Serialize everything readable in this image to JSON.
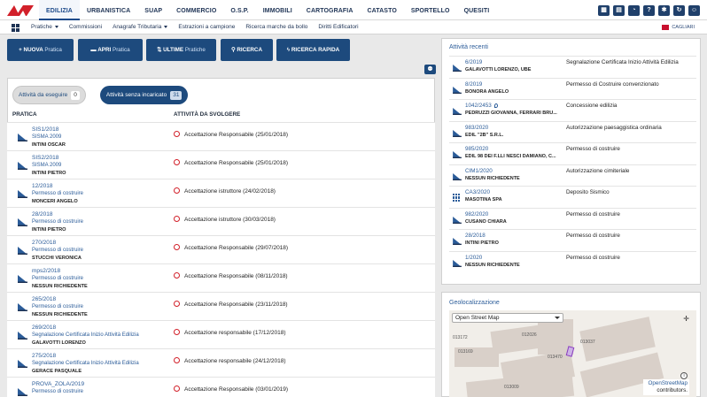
{
  "topnav": {
    "items": [
      "EDILIZIA",
      "URBANISTICA",
      "SUAP",
      "COMMERCIO",
      "O.S.P.",
      "IMMOBILI",
      "CARTOGRAFIA",
      "CATASTO",
      "SPORTELLO",
      "QUESITI"
    ],
    "active_index": 0,
    "icons": [
      "grid-icon",
      "calendar-icon",
      "pie-chart-icon",
      "help-icon",
      "settings-icon",
      "refresh-icon",
      "user-icon"
    ],
    "icon_glyphs": [
      "▦",
      "▤",
      "◔",
      "?",
      "✱",
      "↻",
      "☺"
    ]
  },
  "subnav": {
    "items": [
      {
        "label": "Pratiche",
        "dropdown": true
      },
      {
        "label": "Commissioni",
        "dropdown": false
      },
      {
        "label": "Anagrafe Tributaria",
        "dropdown": true
      },
      {
        "label": "Estrazioni a campione",
        "dropdown": false
      },
      {
        "label": "Ricerca marche da bollo",
        "dropdown": false
      },
      {
        "label": "Diritti Edificatori",
        "dropdown": false
      }
    ],
    "city": "CAGLIARI"
  },
  "actions": {
    "nuova": {
      "bold": "NUOVA",
      "light": "Pratica"
    },
    "apri": {
      "bold": "APRI",
      "light": "Pratica"
    },
    "ultime": {
      "bold": "ULTIME",
      "light": "Pratiche"
    },
    "ricerca": "RICERCA",
    "ricerca_rapida": "RICERCA RAPIDA"
  },
  "tabs": {
    "da_eseguire": {
      "label": "Attività da eseguire",
      "count": "0"
    },
    "senza_incaricato": {
      "label": "Attività senza incaricato",
      "count": "31"
    }
  },
  "table": {
    "headers": {
      "pratica": "PRATICA",
      "attivita": "ATTIVITÀ DA SVOLGERE"
    },
    "rows": [
      {
        "num": "SIS1/2018",
        "type": "SISMA 2009",
        "owner": "INTINI OSCAR",
        "activity": "Accettazione Responsabile (25/01/2018)"
      },
      {
        "num": "SIS2/2018",
        "type": "SISMA 2009",
        "owner": "INTINI PIETRO",
        "activity": "Accettazione Responsabile (25/01/2018)"
      },
      {
        "num": "12/2018",
        "type": "Permesso di costruire",
        "owner": "MONCERI ANGELO",
        "activity": "Accettazione istruttore (24/02/2018)"
      },
      {
        "num": "28/2018",
        "type": "Permesso di costruire",
        "owner": "INTINI PIETRO",
        "activity": "Accettazione istruttore (30/03/2018)"
      },
      {
        "num": "270/2018",
        "type": "Permesso di costruire",
        "owner": "STUCCHI VERONICA",
        "activity": "Accettazione Responsabile (29/07/2018)"
      },
      {
        "num": "mps2/2018",
        "type": "Permesso di costruire",
        "owner": "NESSUN RICHIEDENTE",
        "activity": "Accettazione Responsabile (08/11/2018)"
      },
      {
        "num": "265/2018",
        "type": "Permesso di costruire",
        "owner": "NESSUN RICHIEDENTE",
        "activity": "Accettazione Responsabile (23/11/2018)"
      },
      {
        "num": "269/2018",
        "type": "Segnalazione Certificata Inizio Attività Edilizia",
        "owner": "GALAVOTTI LORENZO",
        "activity": "Accettazione responsabile (17/12/2018)"
      },
      {
        "num": "275/2018",
        "type": "Segnalazione Certificata Inizio Attività Edilizia",
        "owner": "GERACE PASQUALE",
        "activity": "Accettazione responsabile (24/12/2018)"
      },
      {
        "num": "PROVA_ZOLA/2019",
        "type": "Permesso di costruire",
        "owner": "",
        "activity": "Accettazione Responsabile (03/01/2019)"
      }
    ]
  },
  "recent": {
    "title": "Attività recenti",
    "items": [
      {
        "num": "6/2019",
        "owner": "GALAVOTTI LORENZO, UBE",
        "desc": "Segnalazione Certificata Inizio Attività Edilizia",
        "icon": "doc",
        "pin": false
      },
      {
        "num": "8/2019",
        "owner": "BONORA ANGELO",
        "desc": "Permesso di Costruire convenzionato",
        "icon": "doc",
        "pin": false
      },
      {
        "num": "1042/2453",
        "owner": "PEDRUZZI GIOVANNA, FERRARI BRU...",
        "desc": "Concessione edilizia",
        "icon": "doc",
        "pin": true
      },
      {
        "num": "983/2020",
        "owner": "EDIL \"2B\" S.R.L.",
        "desc": "Autorizzazione paesaggistica ordinaria",
        "icon": "doc",
        "pin": false
      },
      {
        "num": "985/2020",
        "owner": "EDIL 98 DEI F.LLI NESCI DAMIANO, C...",
        "desc": "Permesso di costruire",
        "icon": "doc",
        "pin": false
      },
      {
        "num": "CIM1/2020",
        "owner": "NESSUN RICHIEDENTE",
        "desc": "Autorizzazione cimiteriale",
        "icon": "doc",
        "pin": false
      },
      {
        "num": "CA3/2020",
        "owner": "MASOTINA SPA",
        "desc": "Deposito Sismico",
        "icon": "grid",
        "pin": false
      },
      {
        "num": "982/2020",
        "owner": "CUSANO CHIARA",
        "desc": "Permesso di costruire",
        "icon": "doc",
        "pin": false
      },
      {
        "num": "28/2018",
        "owner": "INTINI PIETRO",
        "desc": "Permesso di costruire",
        "icon": "doc",
        "pin": false
      },
      {
        "num": "1/2020",
        "owner": "NESSUN RICHIEDENTE",
        "desc": "Permesso di costruire",
        "icon": "doc",
        "pin": false
      }
    ]
  },
  "geo": {
    "title": "Geolocalizzazione",
    "layer": "Open Street Map",
    "parcels": [
      "013172",
      "012026",
      "013037",
      "013169",
      "013470",
      "013009"
    ],
    "attribution": {
      "link": "OpenStreetMap",
      "suffix": "contributors."
    }
  },
  "colors": {
    "navy": "#1d4a7d",
    "link": "#2b5c99",
    "alarm": "#d2202a",
    "logo_red": "#d2202a",
    "highlight_parcel": "#8b3fbf"
  }
}
